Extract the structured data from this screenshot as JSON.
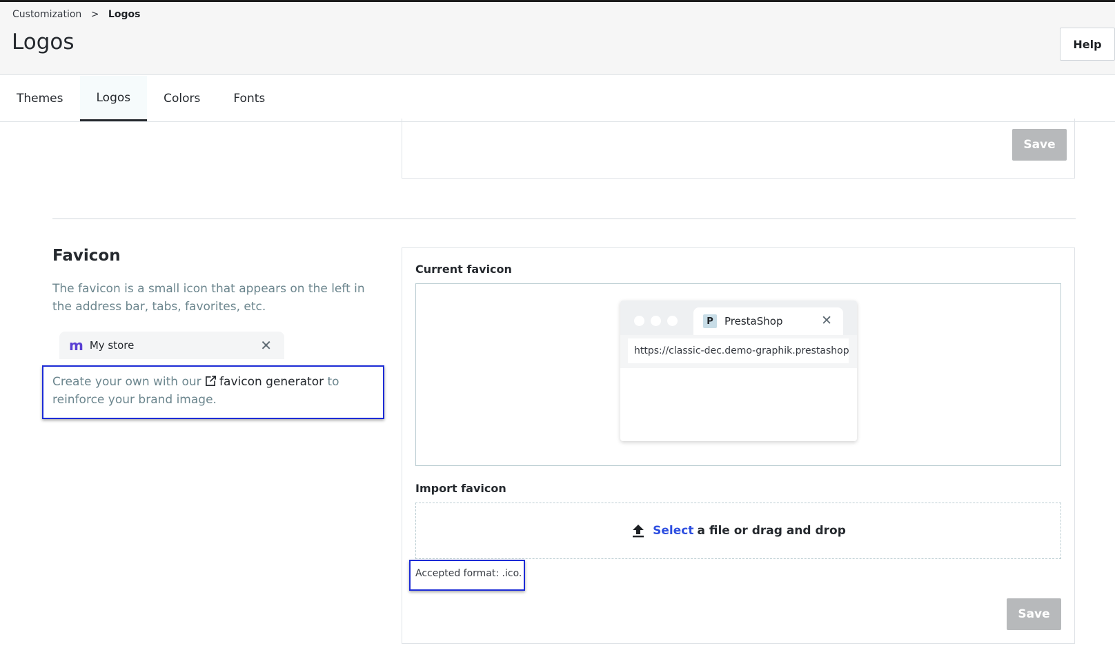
{
  "header": {
    "breadcrumb": {
      "parent": "Customization",
      "separator": ">",
      "current": "Logos"
    },
    "title": "Logos",
    "help_label": "Help"
  },
  "tabs": [
    {
      "label": "Themes",
      "active": false
    },
    {
      "label": "Logos",
      "active": true
    },
    {
      "label": "Colors",
      "active": false
    },
    {
      "label": "Fonts",
      "active": false
    }
  ],
  "top_card": {
    "save_label": "Save"
  },
  "favicon_section": {
    "title": "Favicon",
    "description": "The favicon is a small icon that appears on the left in the address bar, tabs, favorites, etc.",
    "preview_tab": {
      "store_name": "My store",
      "close": "✕"
    },
    "generator": {
      "prefix": "Create your own with our",
      "link": "favicon generator",
      "suffix": "to reinforce your brand image."
    }
  },
  "favicon_card": {
    "current_label": "Current favicon",
    "browser": {
      "tab_title": "PrestaShop",
      "tab_icon_letter": "P",
      "close": "✕",
      "url": "https://classic-dec.demo-graphik.prestashop"
    },
    "import_label": "Import favicon",
    "dropzone": {
      "select": "Select",
      "rest": "a file or drag and drop"
    },
    "accepted_format": "Accepted format: .ico.",
    "save_label": "Save"
  },
  "colors": {
    "highlight_border": "#1c2bd6",
    "link_blue": "#2d4ee0",
    "disabled_button": "#b7b9bb"
  }
}
